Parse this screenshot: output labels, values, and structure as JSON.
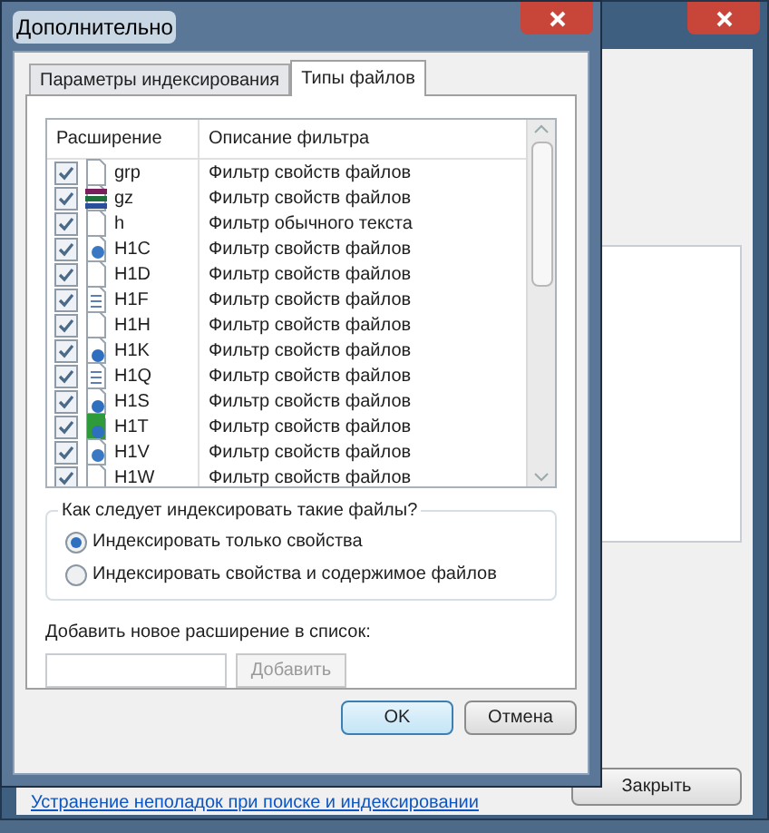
{
  "background_window": {
    "link": "Устранение неполадок при поиске и индексировании",
    "close_button": "Закрыть"
  },
  "dialog": {
    "title": "Дополнительно",
    "tabs": [
      {
        "label": "Параметры индексирования",
        "selected": false
      },
      {
        "label": "Типы файлов",
        "selected": true
      }
    ],
    "table": {
      "columns": [
        "Расширение",
        "Описание фильтра"
      ],
      "rows": [
        {
          "extension": "grp",
          "kind": "blank",
          "description": "Фильтр свойств файлов",
          "checked": true
        },
        {
          "extension": "gz",
          "kind": "archive",
          "description": "Фильтр свойств файлов",
          "checked": true
        },
        {
          "extension": "h",
          "kind": "blank",
          "description": "Фильтр обычного текста",
          "checked": true
        },
        {
          "extension": "H1C",
          "kind": "app",
          "description": "Фильтр свойств файлов",
          "checked": true
        },
        {
          "extension": "H1D",
          "kind": "blank",
          "description": "Фильтр свойств файлов",
          "checked": true
        },
        {
          "extension": "H1F",
          "kind": "doc",
          "description": "Фильтр свойств файлов",
          "checked": true
        },
        {
          "extension": "H1H",
          "kind": "blank",
          "description": "Фильтр свойств файлов",
          "checked": true
        },
        {
          "extension": "H1K",
          "kind": "help",
          "description": "Фильтр свойств файлов",
          "checked": true
        },
        {
          "extension": "H1Q",
          "kind": "doc",
          "description": "Фильтр свойств файлов",
          "checked": true
        },
        {
          "extension": "H1S",
          "kind": "help",
          "description": "Фильтр свойств файлов",
          "checked": true
        },
        {
          "extension": "H1T",
          "kind": "helpgreen",
          "description": "Фильтр свойств файлов",
          "checked": true
        },
        {
          "extension": "H1V",
          "kind": "app",
          "description": "Фильтр свойств файлов",
          "checked": true
        },
        {
          "extension": "H1W",
          "kind": "blank",
          "description": "Фильтр свойств файлов",
          "checked": true
        }
      ]
    },
    "index_group": {
      "title": "Как следует индексировать такие файлы?",
      "options": [
        {
          "label": "Индексировать только свойства",
          "selected": true
        },
        {
          "label": "Индексировать свойства и содержимое файлов",
          "selected": false
        }
      ]
    },
    "add_label": "Добавить новое расширение в список:",
    "add_button": {
      "label": "Добавить",
      "disabled": true
    },
    "buttons": [
      {
        "label": "OK",
        "kind": "default"
      },
      {
        "label": "Отмена",
        "kind": "normal"
      }
    ]
  }
}
